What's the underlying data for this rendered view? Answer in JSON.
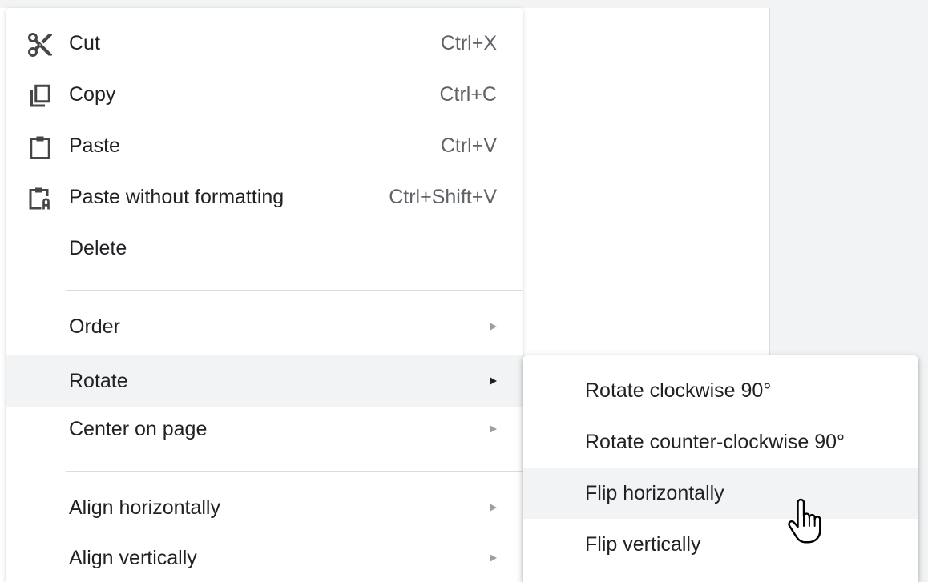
{
  "menu": {
    "items": [
      {
        "label": "Cut",
        "shortcut": "Ctrl+X",
        "icon": "scissors-icon"
      },
      {
        "label": "Copy",
        "shortcut": "Ctrl+C",
        "icon": "copy-icon"
      },
      {
        "label": "Paste",
        "shortcut": "Ctrl+V",
        "icon": "clipboard-icon"
      },
      {
        "label": "Paste without formatting",
        "shortcut": "Ctrl+Shift+V",
        "icon": "paste-plain-icon"
      },
      {
        "label": "Delete"
      },
      {
        "label": "Order",
        "submenu": true
      },
      {
        "label": "Rotate",
        "submenu": true,
        "highlighted": true
      },
      {
        "label": "Center on page",
        "submenu": true
      },
      {
        "label": "Align horizontally",
        "submenu": true
      },
      {
        "label": "Align vertically",
        "submenu": true
      }
    ]
  },
  "submenu": {
    "items": [
      {
        "label": "Rotate clockwise 90°"
      },
      {
        "label": "Rotate counter-clockwise 90°"
      },
      {
        "label": "Flip horizontally",
        "highlighted": true
      },
      {
        "label": "Flip vertically"
      }
    ]
  },
  "colors": {
    "text": "#202124",
    "shortcut": "#5f6368",
    "hover": "#f1f3f4",
    "divider": "#dadce0"
  },
  "cursor": "hand-pointer-icon"
}
